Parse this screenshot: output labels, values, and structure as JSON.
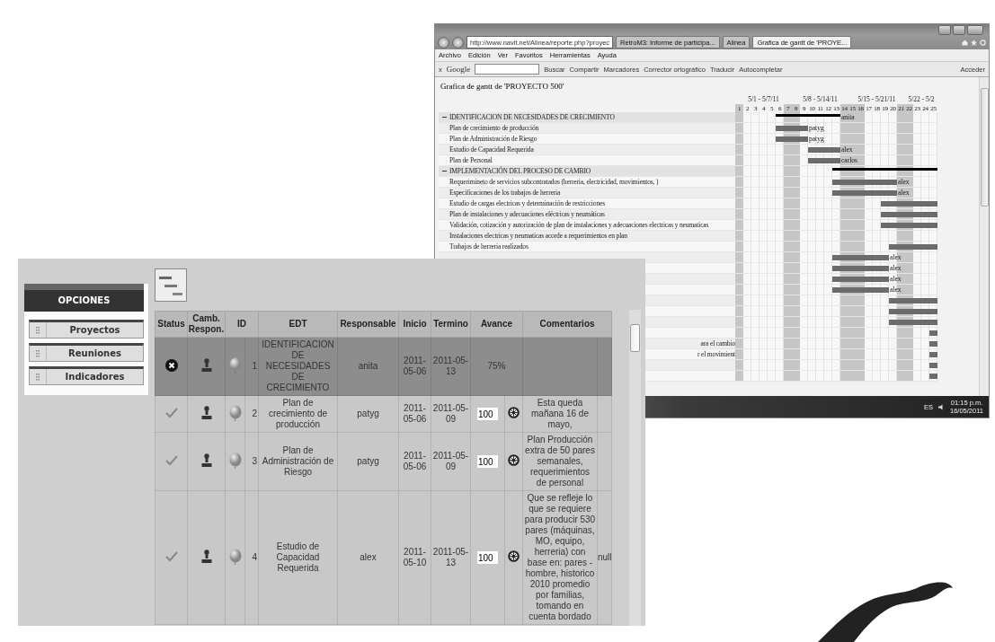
{
  "browser": {
    "url": "http://www.navit.net/Alinea/reporte.php?proyec",
    "tabs": [
      {
        "label": "RetroM3: Informe de participa...",
        "selected": false
      },
      {
        "label": "Alinea",
        "selected": false
      },
      {
        "label": "Grafica de gantt de 'PROYE...",
        "selected": true
      }
    ],
    "menu": [
      "Archivo",
      "Edición",
      "Ver",
      "Favoritos",
      "Herramientas",
      "Ayuda"
    ],
    "toolbar": {
      "close": "x",
      "brand": "Google",
      "buttons": [
        "Buscar",
        "Compartir",
        "Marcadores",
        "Corrector ortográfico",
        "Traducir",
        "Autocompletar"
      ],
      "sign_in": "Acceder"
    },
    "page_title": "Grafica de gantt de 'PROYECTO 500'",
    "gantt": {
      "weeks": [
        "5/1 - 5/7/11",
        "5/8 - 5/14/11",
        "5/15 - 5/21/11",
        "5/22 - 5/2"
      ],
      "days": [
        {
          "label": "1",
          "shaded": true
        },
        {
          "label": "2",
          "shaded": false
        },
        {
          "label": "3",
          "shaded": false
        },
        {
          "label": "4",
          "shaded": false
        },
        {
          "label": "5",
          "shaded": false
        },
        {
          "label": "6",
          "shaded": false
        },
        {
          "label": "7",
          "shaded": true
        },
        {
          "label": "8",
          "shaded": true
        },
        {
          "label": "9",
          "shaded": false
        },
        {
          "label": "10",
          "shaded": false
        },
        {
          "label": "11",
          "shaded": false
        },
        {
          "label": "12",
          "shaded": false
        },
        {
          "label": "13",
          "shaded": false
        },
        {
          "label": "14",
          "shaded": true
        },
        {
          "label": "15",
          "shaded": true
        },
        {
          "label": "16",
          "shaded": true
        },
        {
          "label": "17",
          "shaded": false
        },
        {
          "label": "18",
          "shaded": false
        },
        {
          "label": "19",
          "shaded": false
        },
        {
          "label": "20",
          "shaded": false
        },
        {
          "label": "21",
          "shaded": true
        },
        {
          "label": "22",
          "shaded": true
        },
        {
          "label": "23",
          "shaded": false
        },
        {
          "label": "24",
          "shaded": false
        },
        {
          "label": "25",
          "shaded": false
        }
      ],
      "rows": [
        {
          "kind": "group",
          "label": "IDENTIFICACION DE NECESIDADES DE CRECIMIENTO",
          "expanded": true,
          "resource": "anita"
        },
        {
          "kind": "task",
          "label": "Plan de crecimiento de producción",
          "resource": "patyg"
        },
        {
          "kind": "task",
          "label": "Plan de Administración de Riesgo",
          "resource": "patyg"
        },
        {
          "kind": "task",
          "label": "Estudio de Capacidad Requerida",
          "resource": "alex"
        },
        {
          "kind": "task",
          "label": "Plan de Personal",
          "resource": "carlos"
        },
        {
          "kind": "group",
          "label": "IMPLEMENTACIÓN DEL PROCESO DE CAMBIO",
          "expanded": true
        },
        {
          "kind": "task",
          "label": "Requerimineto de servicios subcontratados (herreria, electricidad, movimientos, )",
          "resource": "alex"
        },
        {
          "kind": "task",
          "label": "Especificaciones de los trabajos de herreria",
          "resource": "alex"
        },
        {
          "kind": "task",
          "label": "Estudio de cargas electricas y determinación de restricciones"
        },
        {
          "kind": "task",
          "label": "Plan de instalaciones y adecuaciones eléctricas y neumáticas"
        },
        {
          "kind": "task",
          "label": "Validación, cotización y autorización de plan de instalaciones y adecuaciones electricas y neumaticas"
        },
        {
          "kind": "task",
          "label": "Instalaciones electricas y neumaticas acorde a requerimientos en plan"
        },
        {
          "kind": "task",
          "label": "Trabajos de herreria realizados"
        },
        {
          "kind": "task",
          "resource": "alex"
        },
        {
          "kind": "task",
          "resource": "alex"
        },
        {
          "kind": "task",
          "resource": "alex"
        },
        {
          "kind": "task",
          "resource": "alex"
        },
        {
          "kind": "task"
        },
        {
          "kind": "task"
        },
        {
          "kind": "task"
        },
        {
          "kind": "task"
        },
        {
          "kind": "task",
          "label_tail": "ara el cambio"
        },
        {
          "kind": "task",
          "label_tail": "r el movimient"
        },
        {
          "kind": "task"
        },
        {
          "kind": "task"
        }
      ]
    },
    "taskbar": {
      "language": "ES",
      "time": "01:15 p.m.",
      "date": "16/05/2011"
    }
  },
  "app": {
    "sidebar": {
      "title": "OPCIONES",
      "items": [
        {
          "label": "Proyectos",
          "selected": false
        },
        {
          "label": "Reuniones",
          "selected": false
        },
        {
          "label": "Indicadores",
          "selected": false
        }
      ]
    },
    "table": {
      "columns": [
        "Status",
        "Camb. Respon.",
        "ID",
        "EDT",
        "Responsable",
        "Inicio",
        "Termino",
        "Avance",
        "Comentarios"
      ],
      "rows": [
        {
          "kind": "group",
          "done": false,
          "id": "1",
          "edt": "IDENTIFICACION DE NECESIDADES DE CRECIMIENTO",
          "responsable": "anita",
          "inicio": "2011-05-06",
          "termino": "2011-05-13",
          "avance": "75%"
        },
        {
          "kind": "task",
          "done": true,
          "id": "2",
          "edt": "Plan de crecimiento de producción",
          "responsable": "patyg",
          "inicio": "2011-05-06",
          "termino": "2011-05-09",
          "avance": "100",
          "comment": "Esta queda mañana 16 de mayo,"
        },
        {
          "kind": "task",
          "done": true,
          "id": "3",
          "edt": "Plan de Administración de Riesgo",
          "responsable": "patyg",
          "inicio": "2011-05-06",
          "termino": "2011-05-09",
          "avance": "100",
          "comment": "Plan Producción extra de 50 pares semanales, requerimientos de personal"
        },
        {
          "kind": "task",
          "done": true,
          "id": "4",
          "edt": "Estudio de Capacidad Requerida",
          "responsable": "alex",
          "inicio": "2011-05-10",
          "termino": "2011-05-13",
          "avance": "100",
          "comment": "Que se refleje lo que se requiere para producir 530 pares (máquinas, MO, equipo, herreria) con base en: pares - hombre, historico 2010 promedio por familias, tomando en cuenta bordado",
          "extra": "null"
        }
      ]
    }
  }
}
